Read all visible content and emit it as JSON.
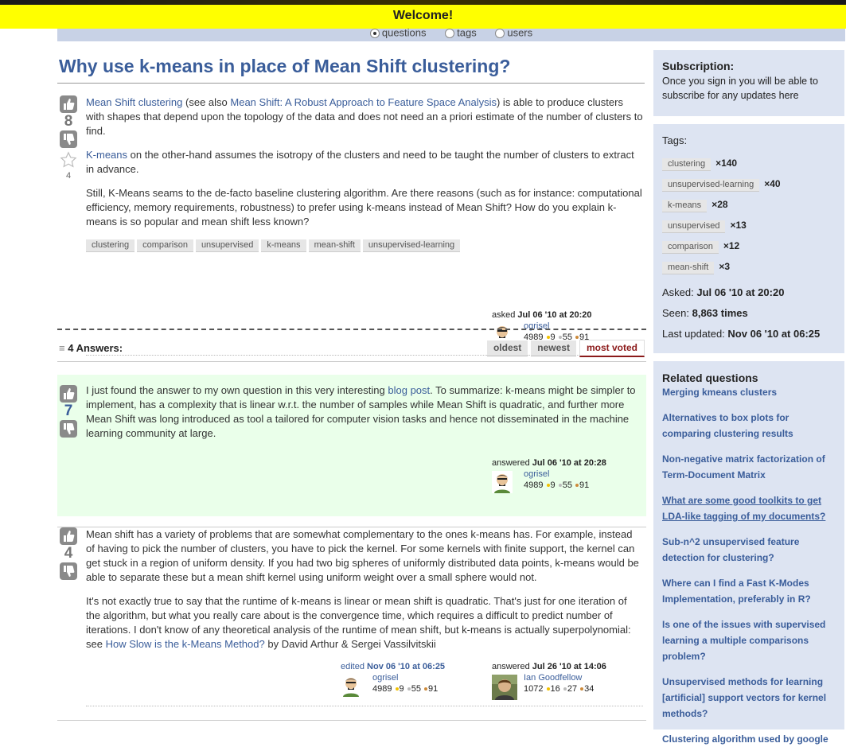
{
  "header": {
    "welcome": "Welcome!"
  },
  "nav": {
    "options": [
      {
        "label": "questions",
        "selected": true
      },
      {
        "label": "tags",
        "selected": false
      },
      {
        "label": "users",
        "selected": false
      }
    ]
  },
  "question": {
    "title": "Why use k-means in place of Mean Shift clustering?",
    "votes": "8",
    "favorites": "4",
    "p1": {
      "link1": "Mean Shift clustering",
      "text1": " (see also ",
      "link2": "Mean Shift: A Robust Approach to Feature Space Analysis",
      "text2": ") is able to produce clusters with shapes that depend upon the topology of the data and does not need an a priori estimate of the number of clusters to find."
    },
    "p2": {
      "link1": "K-means",
      "text1": " on the other-hand assumes the isotropy of the clusters and need to be taught the number of clusters to extract in advance."
    },
    "p3": "Still, K-Means seams to the de-facto baseline clustering algorithm. Are there reasons (such as for instance: computational efficiency, memory requirements, robustness) to prefer using k-means instead of Mean Shift? How do you explain k-means is so popular and mean shift less known?",
    "tags": [
      "clustering",
      "comparison",
      "unsupervised",
      "k-means",
      "mean-shift",
      "unsupervised-learning"
    ],
    "asked": {
      "label": "asked",
      "date": "Jul 06 '10 at 20:20",
      "user": "ogrisel",
      "rep": "4989",
      "gold": "9",
      "silver": "55",
      "bronze": "91"
    }
  },
  "answers_header": {
    "count": "4 Answers:",
    "tabs": [
      "oldest",
      "newest",
      "most voted"
    ]
  },
  "answer1": {
    "votes": "7",
    "text_before": "I just found the answer to my own question in this very interesting ",
    "link": "blog post",
    "text_after": ". To summarize: k-means might be simpler to implement, has a complexity that is linear w.r.t. the number of samples while Mean Shift is quadratic, and further more Mean Shift was long introduced as tool a tailored for computer vision tasks and hence not disseminated in the machine learning community at large.",
    "answered": {
      "label": "answered",
      "date": "Jul 06 '10 at 20:28",
      "user": "ogrisel",
      "rep": "4989",
      "gold": "9",
      "silver": "55",
      "bronze": "91"
    }
  },
  "answer2": {
    "votes": "4",
    "p1": "Mean shift has a variety of problems that are somewhat complementary to the ones k-means has. For example, instead of having to pick the number of clusters, you have to pick the kernel. For some kernels with finite support, the kernel can get stuck in a region of uniform density. If you had two big spheres of uniformly distributed data points, k-means would be able to separate these but a mean shift kernel using uniform weight over a small sphere would not.",
    "p2_text": "It's not exactly true to say that the runtime of k-means is linear or mean shift is quadratic. That's just for one iteration of the algorithm, but what you really care about is the convergence time, which requires a difficult to predict number of iterations. I don't know of any theoretical analysis of the runtime of mean shift, but k-means is actually superpolynomial: see ",
    "p2_link": "How Slow is the k-Means Method?",
    "p2_after": " by David Arthur & Sergei Vassilvitskii",
    "edited": {
      "label": "edited",
      "date": "Nov 06 '10 at 06:25",
      "user": "ogrisel",
      "rep": "4989",
      "gold": "9",
      "silver": "55",
      "bronze": "91"
    },
    "answered": {
      "label": "answered",
      "date": "Jul 26 '10 at 14:06",
      "user": "Ian Goodfellow",
      "rep": "1072",
      "gold": "16",
      "silver": "27",
      "bronze": "34"
    }
  },
  "sidebar": {
    "subscription": {
      "title": "Subscription:",
      "text": "Once you sign in you will be able to subscribe for any updates here"
    },
    "tags_title": "Tags:",
    "tags": [
      {
        "name": "clustering",
        "count": "×140"
      },
      {
        "name": "unsupervised-learning",
        "count": "×40"
      },
      {
        "name": "k-means",
        "count": "×28"
      },
      {
        "name": "unsupervised",
        "count": "×13"
      },
      {
        "name": "comparison",
        "count": "×12"
      },
      {
        "name": "mean-shift",
        "count": "×3"
      }
    ],
    "asked_label": "Asked:",
    "asked_value": "Jul 06 '10 at 20:20",
    "seen_label": "Seen:",
    "seen_value": "8,863 times",
    "updated_label": "Last updated:",
    "updated_value": "Nov 06 '10 at 06:25",
    "related_title": "Related questions",
    "related": [
      "Merging kmeans clusters",
      "Alternatives to box plots for comparing clustering results",
      "Non-negative matrix factorization of Term-Document Matrix",
      "What are some good toolkits to get LDA-like tagging of my documents?",
      "Sub-n^2 unsupervised feature detection for clustering?",
      "Where can I find a Fast K-Modes Implementation, preferably in R?",
      "Is one of the issues with supervised learning a multiple comparisons problem?",
      "Unsupervised methods for learning [artificial] support vectors for kernel methods?",
      "Clustering algorithm used by google"
    ]
  }
}
